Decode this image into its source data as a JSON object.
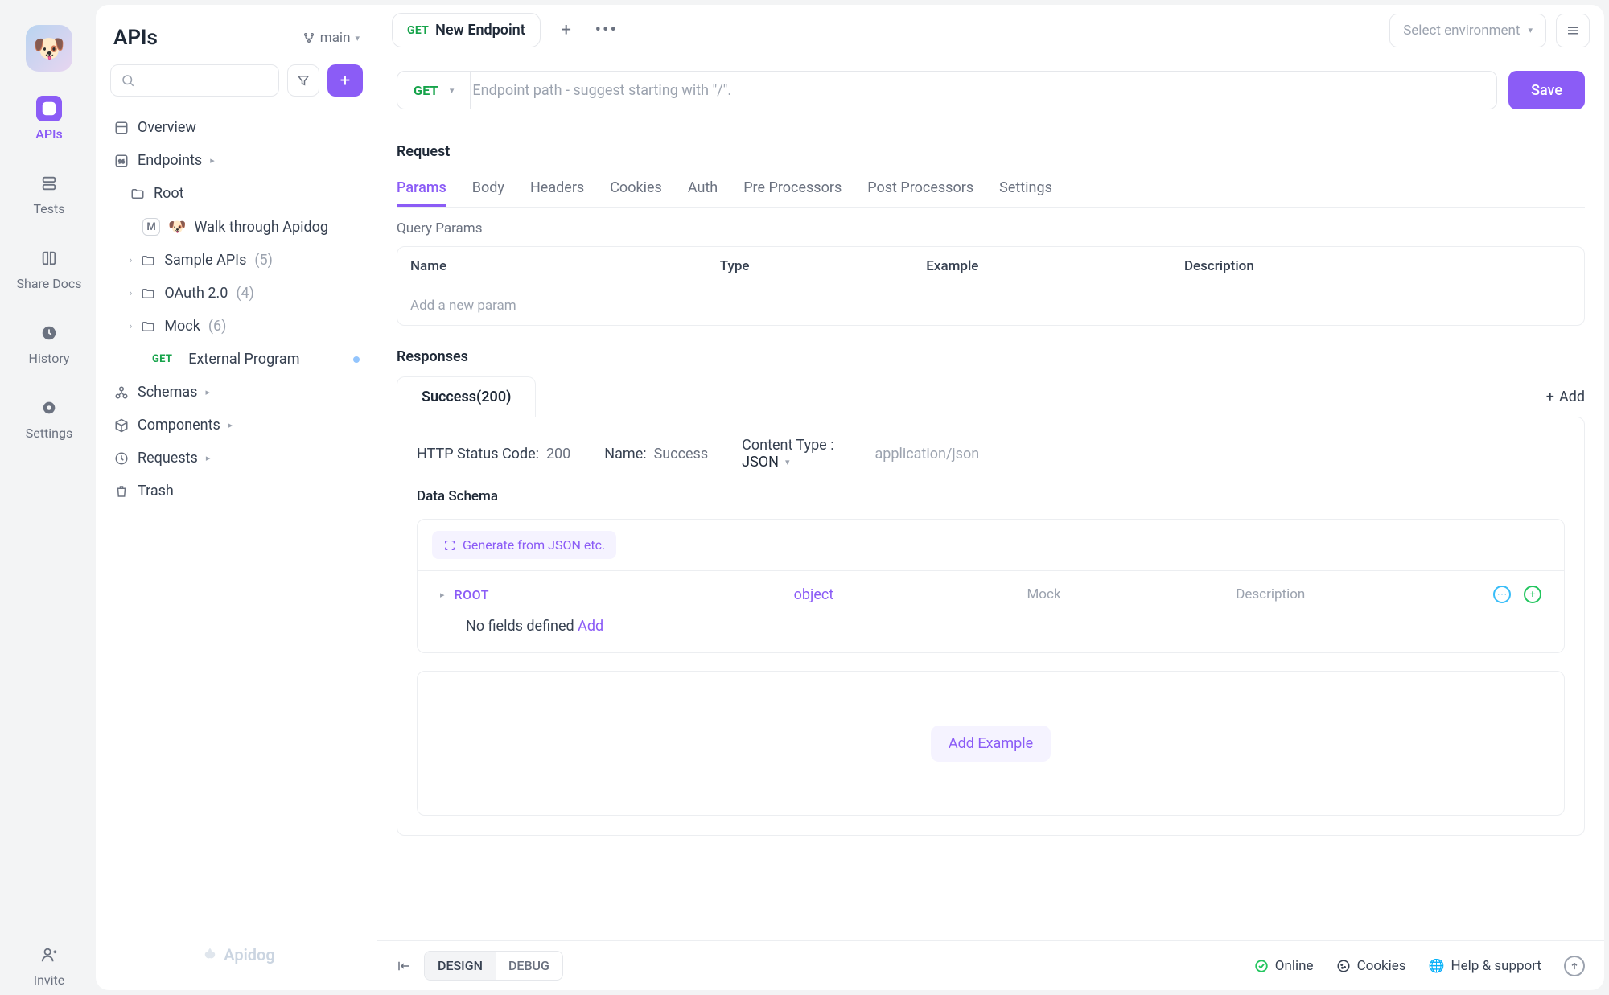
{
  "rail": {
    "items": [
      {
        "label": "APIs"
      },
      {
        "label": "Tests"
      },
      {
        "label": "Share Docs"
      },
      {
        "label": "History"
      },
      {
        "label": "Settings"
      }
    ],
    "invite_label": "Invite"
  },
  "sidebar": {
    "title": "APIs",
    "branch": "main",
    "tree": {
      "overview": "Overview",
      "endpoints": "Endpoints",
      "root": "Root",
      "walkthrough": "Walk through Apidog",
      "sample_apis": "Sample APIs",
      "sample_count": "(5)",
      "oauth": "OAuth 2.0",
      "oauth_count": "(4)",
      "mock": "Mock",
      "mock_count": "(6)",
      "ext_method": "GET",
      "ext_label": "External Program",
      "schemas": "Schemas",
      "components": "Components",
      "requests": "Requests",
      "trash": "Trash"
    },
    "footer_brand": "Apidog"
  },
  "tabbar": {
    "active_method": "GET",
    "active_title": "New Endpoint",
    "env_placeholder": "Select environment"
  },
  "url": {
    "method": "GET",
    "placeholder": "Endpoint path - suggest starting with \"/\".",
    "save": "Save"
  },
  "request": {
    "title": "Request",
    "tabs": [
      "Params",
      "Body",
      "Headers",
      "Cookies",
      "Auth",
      "Pre Processors",
      "Post Processors",
      "Settings"
    ],
    "query_params_label": "Query Params",
    "cols": {
      "name": "Name",
      "type": "Type",
      "example": "Example",
      "description": "Description"
    },
    "add_param": "Add a new param"
  },
  "responses": {
    "title": "Responses",
    "tab_label": "Success(200)",
    "add": "Add",
    "status_label": "HTTP Status Code:",
    "status_value": "200",
    "name_label": "Name:",
    "name_value": "Success",
    "ct_label": "Content Type :",
    "ct_value": "JSON",
    "ct_mime": "application/json",
    "schema_title": "Data Schema",
    "generate": "Generate from JSON etc.",
    "root": "ROOT",
    "object": "object",
    "mock": "Mock",
    "description": "Description",
    "no_fields": "No fields defined",
    "add_field": "Add",
    "add_example": "Add Example"
  },
  "footer": {
    "modes": {
      "design": "DESIGN",
      "debug": "DEBUG"
    },
    "online": "Online",
    "cookies": "Cookies",
    "help": "Help & support"
  }
}
